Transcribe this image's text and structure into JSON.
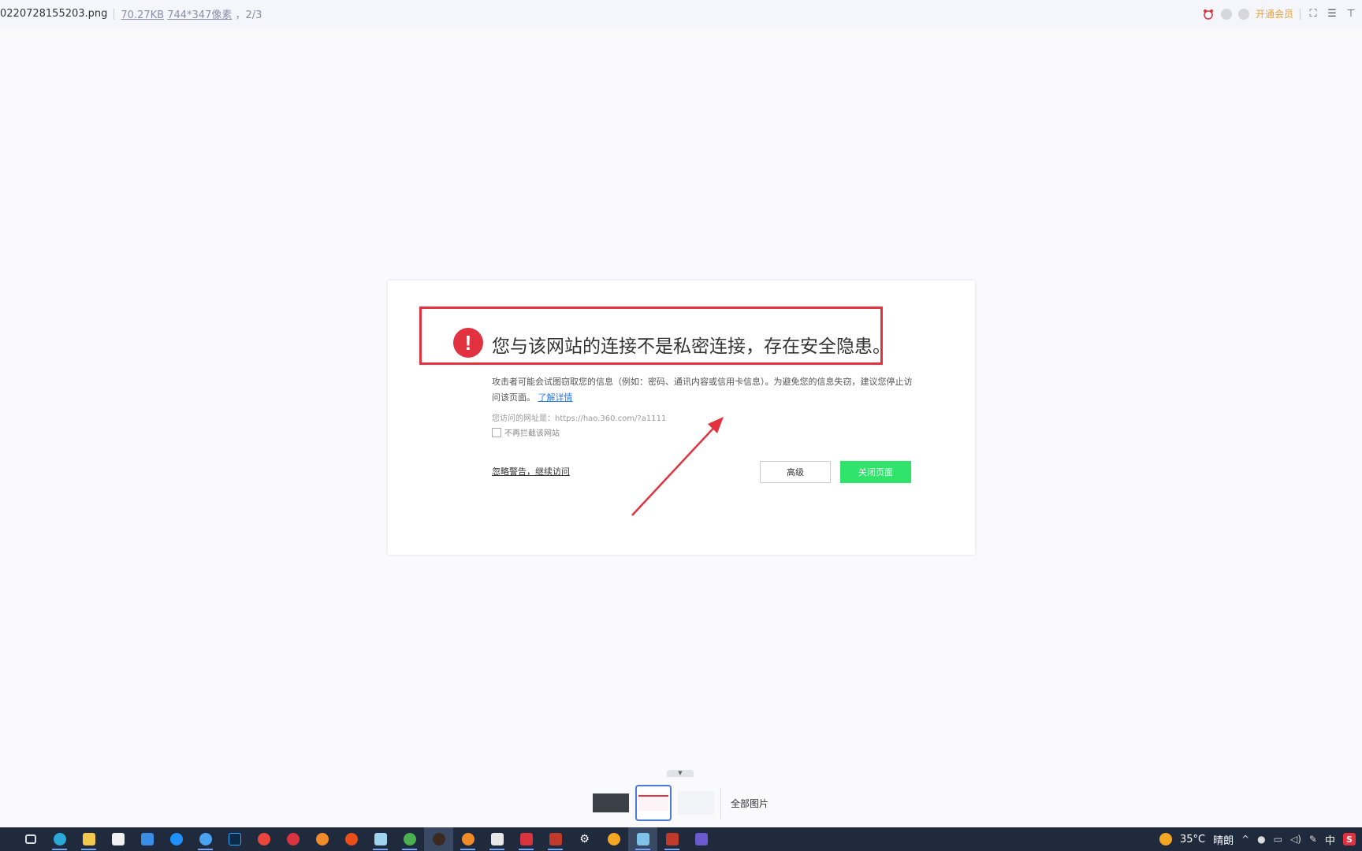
{
  "topbar": {
    "filename": "0220728155203.png",
    "filesize": "70.27KB",
    "dimensions": "744*347像素",
    "position": "，2/3",
    "vip_label": "开通会员",
    "icons": [
      "alarm-icon",
      "gear-icon",
      "shield-icon",
      "fullscreen-icon",
      "menu-icon",
      "pin-icon"
    ]
  },
  "warning_page": {
    "title": "您与该网站的连接不是私密连接，存在安全隐患。",
    "description": "攻击者可能会试图窃取您的信息（例如：密码、通讯内容或信用卡信息）。为避免您的信息失窃，建议您停止访问该页面。",
    "learn_more": "了解详情",
    "visited_url": "您访问的网址是：https://hao.360.com/?a1111",
    "no_intercept": "不再拦截该网站",
    "ignore_link": "忽略警告，继续访问",
    "advanced_button": "高级",
    "close_button": "关闭页面",
    "accent_color": "#e2323f",
    "button_color": "#2fe36b"
  },
  "thumbnails": {
    "count": 3,
    "selected_index": 2,
    "all_images_label": "全部图片"
  },
  "taskbar": {
    "apps": [
      "task-view-icon",
      "edge-icon",
      "file-explorer-icon",
      "store-icon",
      "mail-icon",
      "app-icon",
      "sogou-icon",
      "photoshop-icon",
      "chrome-icon",
      "app-icon",
      "blender-icon",
      "app-icon",
      "notepad-icon",
      "chrome-icon",
      "app-icon",
      "blender-icon",
      "app-icon",
      "wps-icon",
      "app-icon",
      "settings-icon",
      "app-icon",
      "image-viewer-icon",
      "app-icon",
      "photos-icon"
    ],
    "weather_temp": "35°C",
    "weather_desc": "晴朗",
    "ime": "中"
  }
}
